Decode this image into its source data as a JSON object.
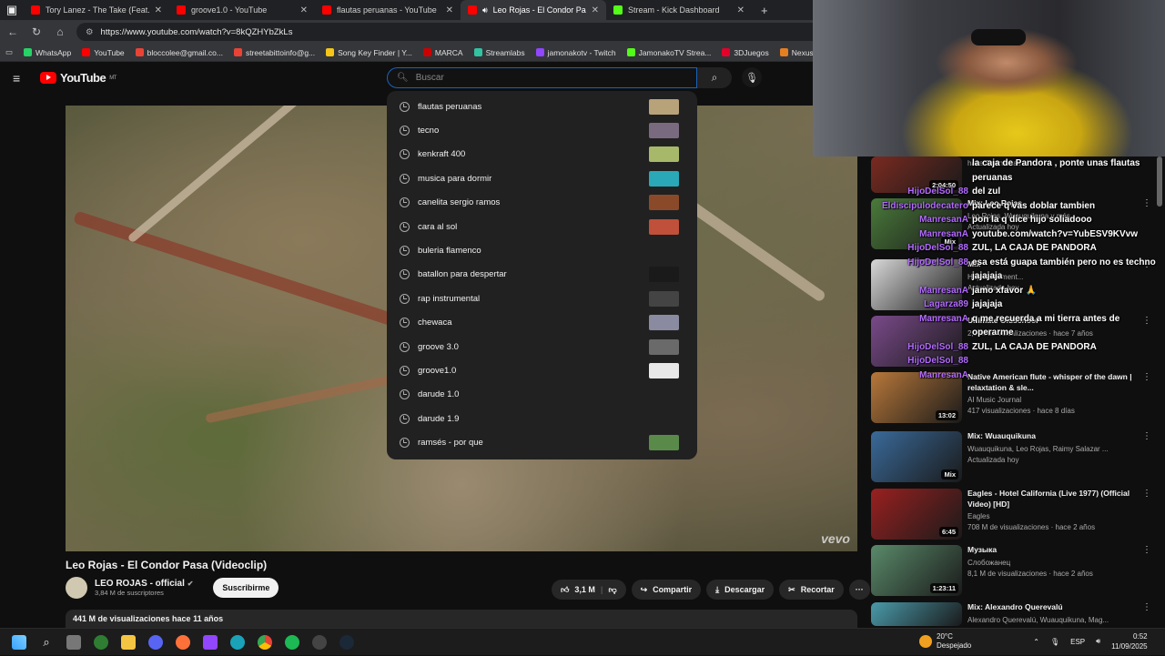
{
  "tabs": [
    {
      "title": "Tory Lanez - The Take (Feat. Chris",
      "color": "#ff0000",
      "active": false
    },
    {
      "title": "groove1.0 - YouTube",
      "color": "#ff0000",
      "active": false
    },
    {
      "title": "flautas peruanas - YouTube",
      "color": "#ff0000",
      "active": false
    },
    {
      "title": "Leo Rojas - El Condor Pasa (",
      "color": "#ff0000",
      "active": true
    },
    {
      "title": "Stream - Kick Dashboard",
      "color": "#53fc18",
      "active": false
    }
  ],
  "address": {
    "url": "https://www.youtube.com/watch?v=8kQZHYbZkLs"
  },
  "bookmarks": [
    {
      "label": "WhatsApp",
      "color": "#25d366"
    },
    {
      "label": "YouTube",
      "color": "#ff0000"
    },
    {
      "label": "bloccolee@gmail.co...",
      "color": "#ea4335"
    },
    {
      "label": "streetabittoinfo@g...",
      "color": "#ea4335"
    },
    {
      "label": "Song Key Finder | Y...",
      "color": "#f5c518"
    },
    {
      "label": "MARCA",
      "color": "#c00"
    },
    {
      "label": "Streamlabs",
      "color": "#31c3a2"
    },
    {
      "label": "jamonakotv - Twitch",
      "color": "#9146ff"
    },
    {
      "label": "JamonakoTV Strea...",
      "color": "#53fc18"
    },
    {
      "label": "3DJuegos",
      "color": "#e4002b"
    },
    {
      "label": "Nexus Clips",
      "color": "#e67e22"
    }
  ],
  "youtube": {
    "logo": "YouTube",
    "country": "MT",
    "search_placeholder": "Buscar"
  },
  "suggestions": [
    {
      "text": "flautas peruanas",
      "thumb": "#b8a27a"
    },
    {
      "text": "tecno",
      "thumb": "#7a6a80"
    },
    {
      "text": "kenkraft 400",
      "thumb": "#a8b86a"
    },
    {
      "text": "musica para dormir",
      "thumb": "#2aa8b8"
    },
    {
      "text": "canelita sergio ramos",
      "thumb": "#8a4a2a"
    },
    {
      "text": "cara al sol",
      "thumb": "#c0503a"
    },
    {
      "text": "buleria flamenco",
      "thumb": ""
    },
    {
      "text": "batallon para despertar",
      "thumb": "#1a1a1a"
    },
    {
      "text": "rap instrumental",
      "thumb": "#444"
    },
    {
      "text": "chewaca",
      "thumb": "#8a8aa0"
    },
    {
      "text": "groove 3.0",
      "thumb": "#6a6a6a"
    },
    {
      "text": "groove1.0",
      "thumb": "#e8e8e8"
    },
    {
      "text": "darude 1.0",
      "thumb": ""
    },
    {
      "text": "darude 1.9",
      "thumb": ""
    },
    {
      "text": "ramsés - por que",
      "thumb": "#5a8a4a"
    }
  ],
  "video": {
    "title": "Leo Rojas - El Condor Pasa (Videoclip)",
    "watermark": "vevo"
  },
  "channel": {
    "name": "LEO ROJAS - official",
    "subs": "3,84 M de suscriptores",
    "subscribe": "Suscribirme"
  },
  "actions": {
    "likes": "3,1 M",
    "share": "Compartir",
    "download": "Descargar",
    "clip": "Recortar"
  },
  "description": {
    "stats": "441 M de visualizaciones  hace 11 años"
  },
  "recommendations": [
    {
      "title": "",
      "meta1": "",
      "meta2": "hace 3 semanas",
      "duration": "2:04:50",
      "color": "#7a2a20"
    },
    {
      "title": "Mix: Leo Rojas",
      "meta1": "Leo Rojas, Wuauquikuna y más",
      "meta2": "Actualizada hoy",
      "duration": "Mix",
      "color": "#4a7a3a"
    },
    {
      "title": "Mix",
      "meta1": "Hop Instrument...",
      "meta2": "Actualizada hoy",
      "duration": "",
      "color": "#d8d8d8"
    },
    {
      "title": "Ultimate Oldschool",
      "meta1": "",
      "meta2": "2,9 M de visualizaciones · hace 7 años",
      "duration": "",
      "color": "#7a4a8a"
    },
    {
      "title": "Native American flute - whisper of the dawn | relaxtation & sle...",
      "meta1": "AI Music Journal",
      "meta2": "417 visualizaciones · hace 8 días",
      "duration": "13:02",
      "color": "#b8783a"
    },
    {
      "title": "Mix: Wuauquikuna",
      "meta1": "Wuauquikuna, Leo Rojas, Raimy Salazar ...",
      "meta2": "Actualizada hoy",
      "duration": "Mix",
      "color": "#3a6a9a"
    },
    {
      "title": "Eagles - Hotel California (Live 1977) (Official Video) [HD]",
      "meta1": "Eagles",
      "meta2": "708 M de visualizaciones · hace 2 años",
      "duration": "6:45",
      "color": "#9a2020"
    },
    {
      "title": "Музыка",
      "meta1": "Слобожанец",
      "meta2": "8,1 M de visualizaciones · hace 2 años",
      "duration": "1:23:11",
      "color": "#5a8a6a"
    },
    {
      "title": "Mix: Alexandro Querevalú",
      "meta1": "Alexandro Querevalú, Wuauquikuna, Mag...",
      "meta2": "",
      "duration": "",
      "color": "#4a9aaa"
    }
  ],
  "chat": [
    {
      "user": "",
      "msg": "la caja de Pandora , ponte unas flautas peruanas"
    },
    {
      "user": "HijoDelSol_88",
      "msg": "del zul"
    },
    {
      "user": "Eldiscipulodecatero",
      "msg": "parece q vas doblar tambien"
    },
    {
      "user": "ManresanA",
      "msg": "pon la q dice hijo soliadooo"
    },
    {
      "user": "ManresanA",
      "msg": "youtube.com/watch?v=YubESV9KVvw"
    },
    {
      "user": "HijoDelSol_88",
      "msg": "ZUL, LA CAJA DE PANDORA"
    },
    {
      "user": "HijoDelSol_88",
      "msg": "esa está guapa también pero no es techno jajajaja"
    },
    {
      "user": "ManresanA",
      "msg": "jamo xfavor 🙏"
    },
    {
      "user": "Lagarza89",
      "msg": "jajajaja"
    },
    {
      "user": "ManresanA",
      "msg": "q me recuerda a mi tierra antes de operarme"
    },
    {
      "user": "HijoDelSol_88",
      "msg": "ZUL, LA CAJA DE PANDORA"
    },
    {
      "user": "HijoDelSol_88",
      "msg": ""
    },
    {
      "user": "ManresanA",
      "msg": ""
    }
  ],
  "tray": {
    "temp": "20°C",
    "weather": "Despejado",
    "lang": "ESP",
    "time": "0:52",
    "date": "11/09/2025"
  }
}
